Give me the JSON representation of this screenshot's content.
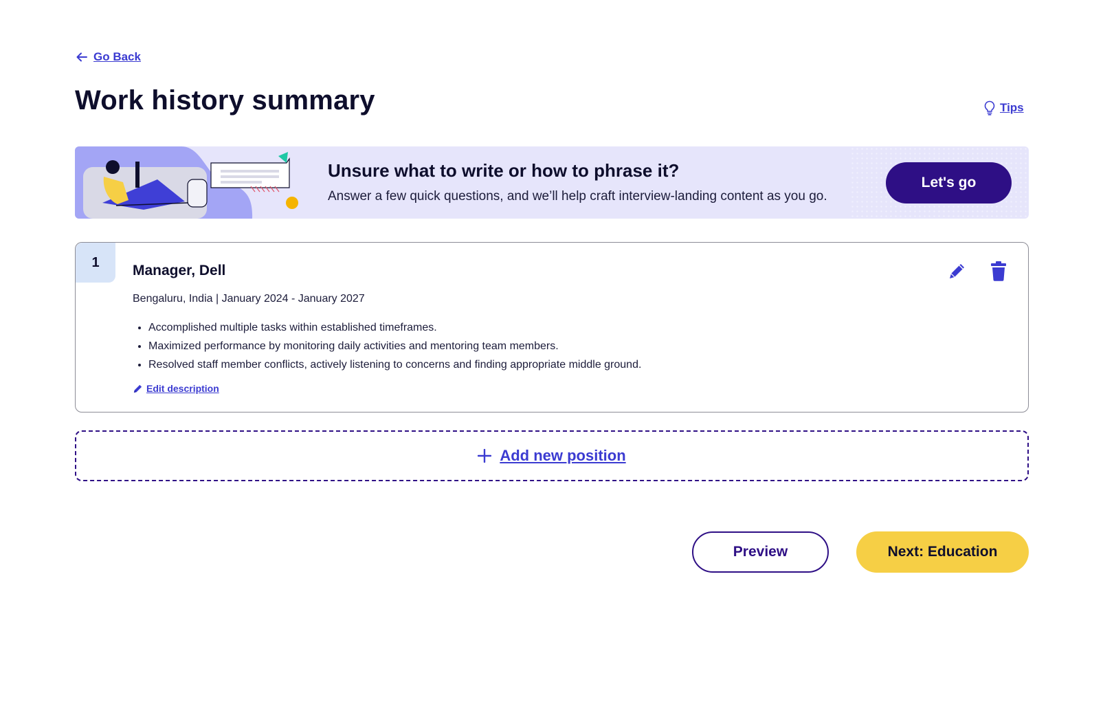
{
  "nav": {
    "go_back_label": "Go Back",
    "go_back_icon": "arrow-left-icon"
  },
  "header": {
    "title": "Work history summary",
    "tips_label": "Tips",
    "tips_icon": "lightbulb-icon"
  },
  "banner": {
    "heading": "Unsure what to write or how to phrase it?",
    "subtext": "Answer a few quick questions, and we’ll help craft interview-landing content as you go.",
    "button_label": "Let's go"
  },
  "positions": [
    {
      "number": "1",
      "title": "Manager, Dell",
      "meta": "Bengaluru, India | January 2024 - January 2027",
      "bullets": [
        "Accomplished multiple tasks within established timeframes.",
        "Maximized performance by monitoring daily activities and mentoring team members.",
        "Resolved staff member conflicts, actively listening to concerns and finding appropriate middle ground."
      ],
      "edit_description_label": "Edit description",
      "edit_icon": "pencil-icon",
      "delete_icon": "trash-icon"
    }
  ],
  "add_position_label": "Add new position",
  "footer": {
    "preview_label": "Preview",
    "next_label": "Next: Education"
  },
  "colors": {
    "link": "#3b3bd1",
    "primary": "#2e0f85",
    "accent_yellow": "#f6cf45",
    "banner_bg": "#e6e5fb",
    "number_badge": "#d7e4f8"
  }
}
